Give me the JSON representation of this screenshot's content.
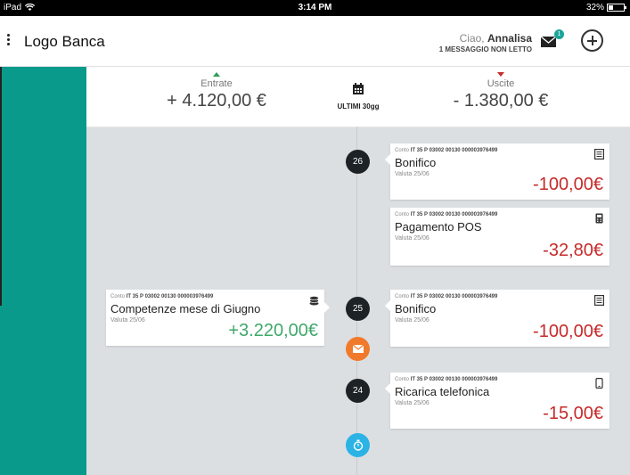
{
  "status_bar": {
    "device": "iPad",
    "time": "3:14 PM",
    "battery": "32%"
  },
  "header": {
    "logo": "Logo Banca",
    "greeting_prefix": "Ciao,",
    "user_name": "Annalisa",
    "messages_text": "1 MESSAGGIO NON LETTO",
    "mail_badge": "1"
  },
  "summary": {
    "income_label": "Entrate",
    "income_amount": "+ 4.120,00 €",
    "period_label": "ULTIMI 30gg",
    "expense_label": "Uscite",
    "expense_amount": "- 1.380,00 €"
  },
  "timeline": {
    "days": [
      "26",
      "25",
      "24"
    ],
    "transactions": [
      {
        "account_prefix": "Conto",
        "account": "IT 35 P 03002 00130 000003976499",
        "title": "Bonifico",
        "valuta": "Valuta 25/06",
        "amount": "-100,00€",
        "icon": "document-icon"
      },
      {
        "account_prefix": "Conto",
        "account": "IT 35 P 03002 00130 000003976499",
        "title": "Pagamento POS",
        "valuta": "Valuta 25/06",
        "amount": "-32,80€",
        "icon": "pos-terminal-icon"
      },
      {
        "account_prefix": "Conto",
        "account": "IT 35 P 03002 00130 000003976499",
        "title": "Competenze mese di Giugno",
        "valuta": "Valuta 25/06",
        "amount": "+3.220,00€",
        "icon": "coins-icon"
      },
      {
        "account_prefix": "Conto",
        "account": "IT 35 P 03002 00130 000003976499",
        "title": "Bonifico",
        "valuta": "Valuta 25/06",
        "amount": "-100,00€",
        "icon": "document-icon"
      },
      {
        "account_prefix": "Conto",
        "account": "IT 35 P 03002 00130 000003976499",
        "title": "Ricarica telefonica",
        "valuta": "Valuta 25/06",
        "amount": "-15,00€",
        "icon": "phone-icon"
      }
    ]
  },
  "colors": {
    "income": "#3fa86b",
    "expense": "#c72a2a",
    "sidebar": "#0a9a8c",
    "mail_event": "#f07a2b",
    "timer_event": "#2bb3e6"
  }
}
